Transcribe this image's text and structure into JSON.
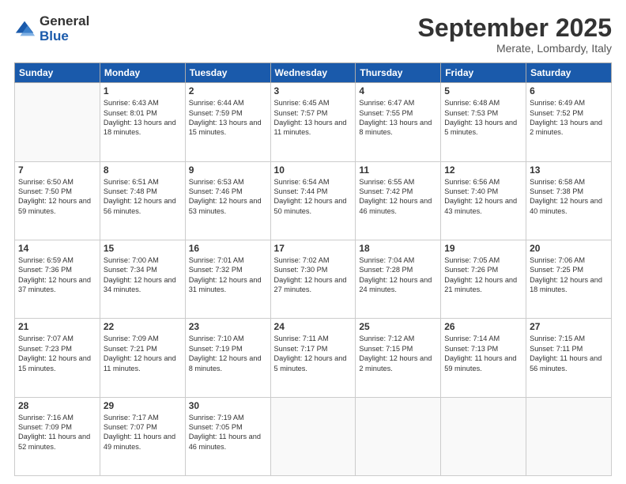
{
  "logo": {
    "general": "General",
    "blue": "Blue"
  },
  "header": {
    "month": "September 2025",
    "location": "Merate, Lombardy, Italy"
  },
  "weekdays": [
    "Sunday",
    "Monday",
    "Tuesday",
    "Wednesday",
    "Thursday",
    "Friday",
    "Saturday"
  ],
  "weeks": [
    [
      {
        "day": "",
        "empty": true
      },
      {
        "day": "1",
        "sunrise": "6:43 AM",
        "sunset": "8:01 PM",
        "daylight": "13 hours and 18 minutes."
      },
      {
        "day": "2",
        "sunrise": "6:44 AM",
        "sunset": "7:59 PM",
        "daylight": "13 hours and 15 minutes."
      },
      {
        "day": "3",
        "sunrise": "6:45 AM",
        "sunset": "7:57 PM",
        "daylight": "13 hours and 11 minutes."
      },
      {
        "day": "4",
        "sunrise": "6:47 AM",
        "sunset": "7:55 PM",
        "daylight": "13 hours and 8 minutes."
      },
      {
        "day": "5",
        "sunrise": "6:48 AM",
        "sunset": "7:53 PM",
        "daylight": "13 hours and 5 minutes."
      },
      {
        "day": "6",
        "sunrise": "6:49 AM",
        "sunset": "7:52 PM",
        "daylight": "13 hours and 2 minutes."
      }
    ],
    [
      {
        "day": "7",
        "sunrise": "6:50 AM",
        "sunset": "7:50 PM",
        "daylight": "12 hours and 59 minutes."
      },
      {
        "day": "8",
        "sunrise": "6:51 AM",
        "sunset": "7:48 PM",
        "daylight": "12 hours and 56 minutes."
      },
      {
        "day": "9",
        "sunrise": "6:53 AM",
        "sunset": "7:46 PM",
        "daylight": "12 hours and 53 minutes."
      },
      {
        "day": "10",
        "sunrise": "6:54 AM",
        "sunset": "7:44 PM",
        "daylight": "12 hours and 50 minutes."
      },
      {
        "day": "11",
        "sunrise": "6:55 AM",
        "sunset": "7:42 PM",
        "daylight": "12 hours and 46 minutes."
      },
      {
        "day": "12",
        "sunrise": "6:56 AM",
        "sunset": "7:40 PM",
        "daylight": "12 hours and 43 minutes."
      },
      {
        "day": "13",
        "sunrise": "6:58 AM",
        "sunset": "7:38 PM",
        "daylight": "12 hours and 40 minutes."
      }
    ],
    [
      {
        "day": "14",
        "sunrise": "6:59 AM",
        "sunset": "7:36 PM",
        "daylight": "12 hours and 37 minutes."
      },
      {
        "day": "15",
        "sunrise": "7:00 AM",
        "sunset": "7:34 PM",
        "daylight": "12 hours and 34 minutes."
      },
      {
        "day": "16",
        "sunrise": "7:01 AM",
        "sunset": "7:32 PM",
        "daylight": "12 hours and 31 minutes."
      },
      {
        "day": "17",
        "sunrise": "7:02 AM",
        "sunset": "7:30 PM",
        "daylight": "12 hours and 27 minutes."
      },
      {
        "day": "18",
        "sunrise": "7:04 AM",
        "sunset": "7:28 PM",
        "daylight": "12 hours and 24 minutes."
      },
      {
        "day": "19",
        "sunrise": "7:05 AM",
        "sunset": "7:26 PM",
        "daylight": "12 hours and 21 minutes."
      },
      {
        "day": "20",
        "sunrise": "7:06 AM",
        "sunset": "7:25 PM",
        "daylight": "12 hours and 18 minutes."
      }
    ],
    [
      {
        "day": "21",
        "sunrise": "7:07 AM",
        "sunset": "7:23 PM",
        "daylight": "12 hours and 15 minutes."
      },
      {
        "day": "22",
        "sunrise": "7:09 AM",
        "sunset": "7:21 PM",
        "daylight": "12 hours and 11 minutes."
      },
      {
        "day": "23",
        "sunrise": "7:10 AM",
        "sunset": "7:19 PM",
        "daylight": "12 hours and 8 minutes."
      },
      {
        "day": "24",
        "sunrise": "7:11 AM",
        "sunset": "7:17 PM",
        "daylight": "12 hours and 5 minutes."
      },
      {
        "day": "25",
        "sunrise": "7:12 AM",
        "sunset": "7:15 PM",
        "daylight": "12 hours and 2 minutes."
      },
      {
        "day": "26",
        "sunrise": "7:14 AM",
        "sunset": "7:13 PM",
        "daylight": "11 hours and 59 minutes."
      },
      {
        "day": "27",
        "sunrise": "7:15 AM",
        "sunset": "7:11 PM",
        "daylight": "11 hours and 56 minutes."
      }
    ],
    [
      {
        "day": "28",
        "sunrise": "7:16 AM",
        "sunset": "7:09 PM",
        "daylight": "11 hours and 52 minutes."
      },
      {
        "day": "29",
        "sunrise": "7:17 AM",
        "sunset": "7:07 PM",
        "daylight": "11 hours and 49 minutes."
      },
      {
        "day": "30",
        "sunrise": "7:19 AM",
        "sunset": "7:05 PM",
        "daylight": "11 hours and 46 minutes."
      },
      {
        "day": "",
        "empty": true
      },
      {
        "day": "",
        "empty": true
      },
      {
        "day": "",
        "empty": true
      },
      {
        "day": "",
        "empty": true
      }
    ]
  ]
}
